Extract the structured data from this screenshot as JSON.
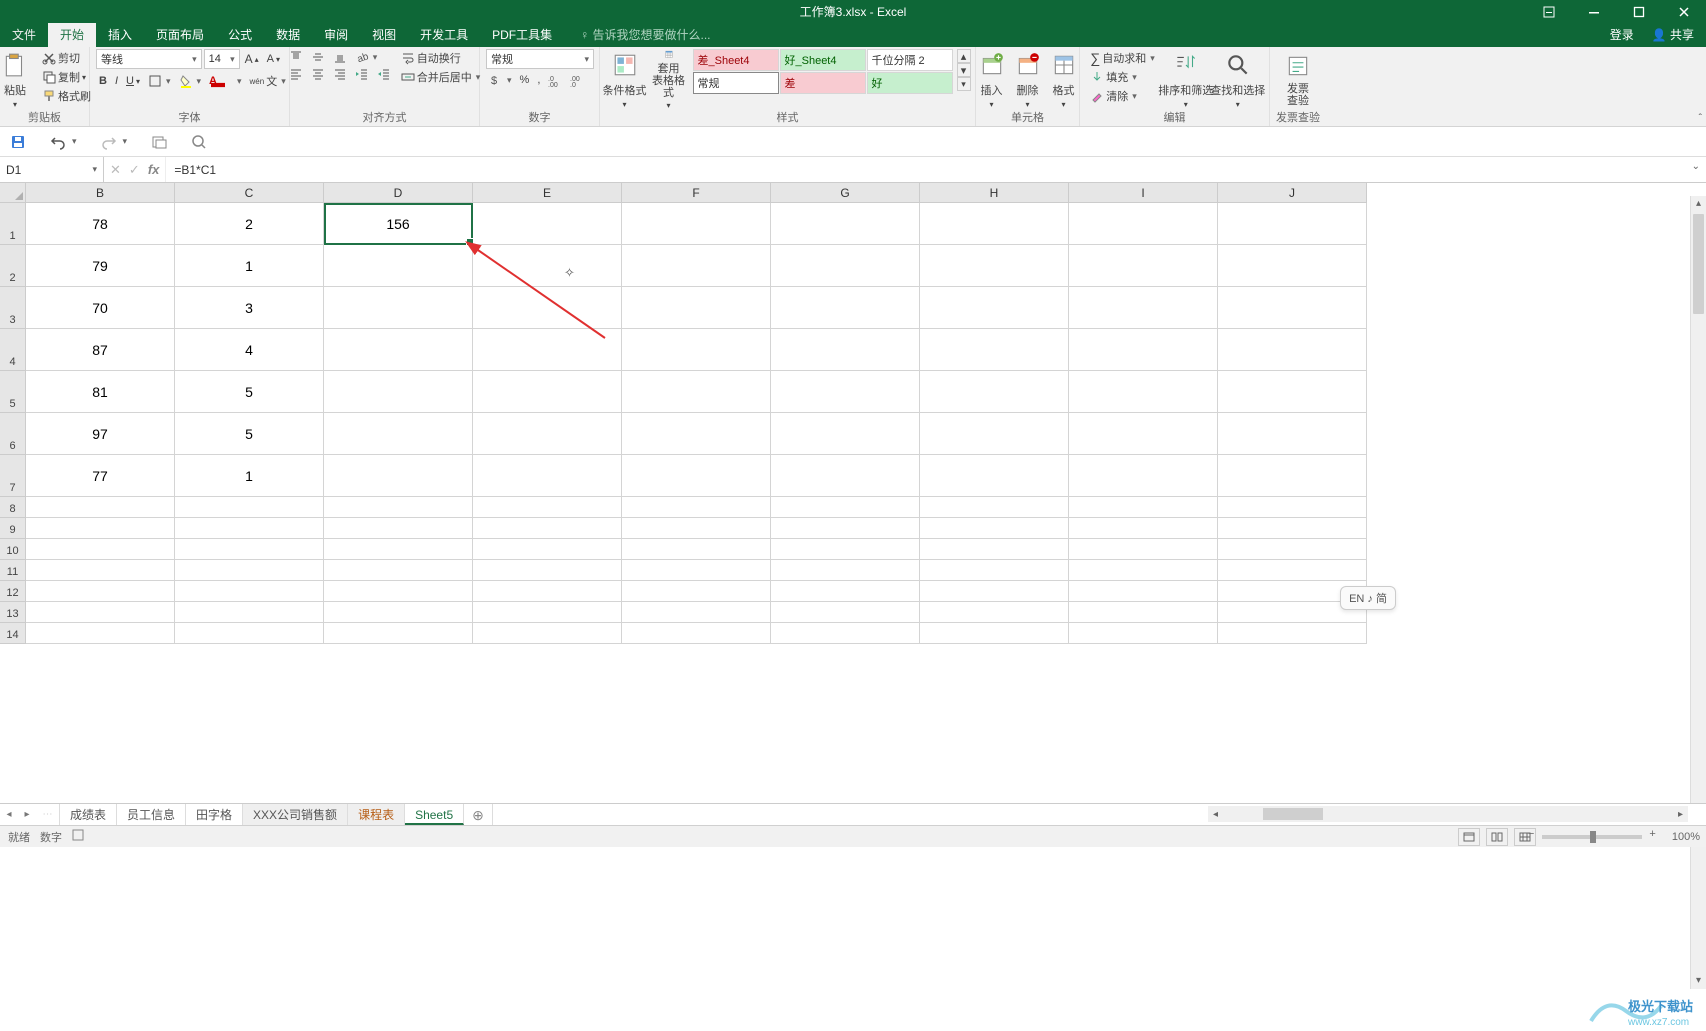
{
  "app": {
    "title": "工作簿3.xlsx - Excel",
    "login": "登录",
    "share": "共享"
  },
  "tabs": {
    "file": "文件",
    "home": "开始",
    "insert": "插入",
    "pageLayout": "页面布局",
    "formulas": "公式",
    "data": "数据",
    "review": "审阅",
    "view": "视图",
    "developer": "开发工具",
    "pdf": "PDF工具集",
    "tellme": "告诉我您想要做什么..."
  },
  "ribbon": {
    "clipboard": {
      "paste": "粘贴",
      "cut": "剪切",
      "copy": "复制",
      "formatPainter": "格式刷",
      "label": "剪贴板"
    },
    "font": {
      "name": "等线",
      "size": "14",
      "label": "字体"
    },
    "alignment": {
      "wrap": "自动换行",
      "merge": "合并后居中",
      "label": "对齐方式"
    },
    "number": {
      "format": "常规",
      "label": "数字"
    },
    "cellStyles": {
      "condFormat": "条件格式",
      "tableFormat": "套用\n表格格式",
      "label": "样式",
      "items": [
        "差_Sheet4",
        "好_Sheet4",
        "千位分隔 2",
        "常规",
        "差",
        "好"
      ]
    },
    "cells": {
      "insert": "插入",
      "delete": "删除",
      "format": "格式",
      "label": "单元格"
    },
    "editing": {
      "autosum": "自动求和",
      "fill": "填充",
      "clear": "清除",
      "sortFilter": "排序和筛选",
      "findSelect": "查找和选择",
      "label": "编辑"
    },
    "invoice": {
      "check": "发票\n查验",
      "label": "发票查验"
    }
  },
  "nameBox": "D1",
  "formula": "=B1*C1",
  "columns": [
    "B",
    "C",
    "D",
    "E",
    "F",
    "G",
    "H",
    "I",
    "J"
  ],
  "rowNums": [
    "1",
    "2",
    "3",
    "4",
    "5",
    "6",
    "7",
    "8",
    "9",
    "10",
    "11",
    "12",
    "13",
    "14"
  ],
  "data": {
    "B": [
      "78",
      "79",
      "70",
      "87",
      "81",
      "97",
      "77",
      "",
      "",
      "",
      "",
      "",
      "",
      ""
    ],
    "C": [
      "2",
      "1",
      "3",
      "4",
      "5",
      "5",
      "1",
      "",
      "",
      "",
      "",
      "",
      "",
      ""
    ],
    "D": [
      "156",
      "",
      "",
      "",
      "",
      "",
      "",
      "",
      "",
      "",
      "",
      "",
      "",
      ""
    ]
  },
  "sheetTabs": [
    "成绩表",
    "员工信息",
    "田字格",
    "XXX公司销售额",
    "课程表",
    "Sheet5"
  ],
  "status": {
    "ready": "就绪",
    "calc": "数字"
  },
  "ime": "EN ♪ 简",
  "zoom": "100%",
  "watermark": {
    "line1": "极光下载站",
    "line2": "www.xz7.com"
  }
}
